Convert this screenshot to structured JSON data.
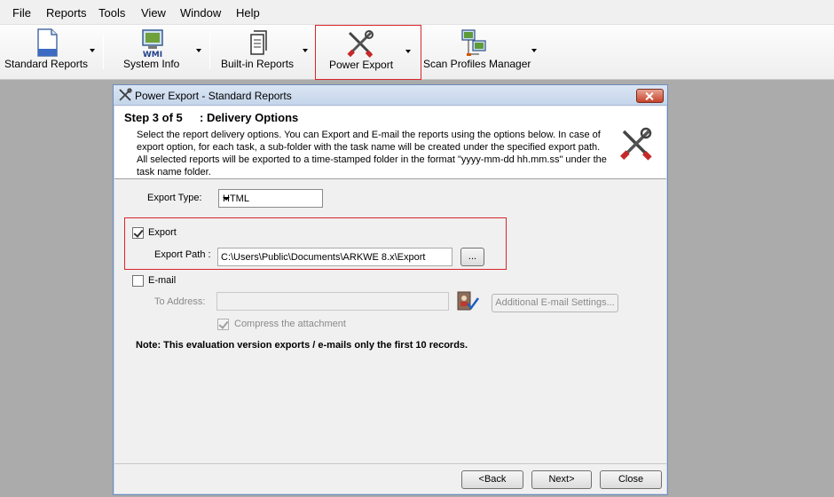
{
  "menu": [
    "File",
    "Reports",
    "Tools",
    "View",
    "Window",
    "Help"
  ],
  "toolbar": {
    "standard_reports": "Standard Reports",
    "system_info": "System Info",
    "system_info_icon_text": "WMI",
    "builtin_reports": "Built-in Reports",
    "power_export": "Power Export",
    "scan_profiles": "Scan Profiles Manager"
  },
  "dialog": {
    "title": "Power Export - Standard Reports",
    "step": "Step 3 of 5",
    "step_title": ": Delivery Options",
    "description": "Select the report delivery options. You can Export and E-mail the reports using the options below. In case of export option, for each task, a sub-folder with the task name will be created under the specified export path. All selected reports will be exported to a time-stamped folder in the format \"yyyy-mm-dd hh.mm.ss\" under the task name folder.",
    "export_type_label": "Export Type:",
    "export_type_value": "HTML",
    "export_label": "Export",
    "export_checked": true,
    "export_path_label": "Export Path :",
    "export_path_value": "C:\\Users\\Public\\Documents\\ARKWE 8.x\\Export",
    "browse_label": "...",
    "email_label": "E-mail",
    "email_checked": false,
    "to_address_label": "To Address:",
    "to_address_value": "",
    "additional_email": "Additional E-mail Settings...",
    "compress_label": "Compress the attachment",
    "compress_checked": true,
    "note": "Note: This evaluation version exports / e-mails only the first 10 records.",
    "back": "<Back",
    "next": "Next>",
    "close": "Close"
  },
  "colors": {
    "highlight_border": "#d9252b",
    "titlebar": "#c5d5ea",
    "workspace": "#ababab"
  }
}
